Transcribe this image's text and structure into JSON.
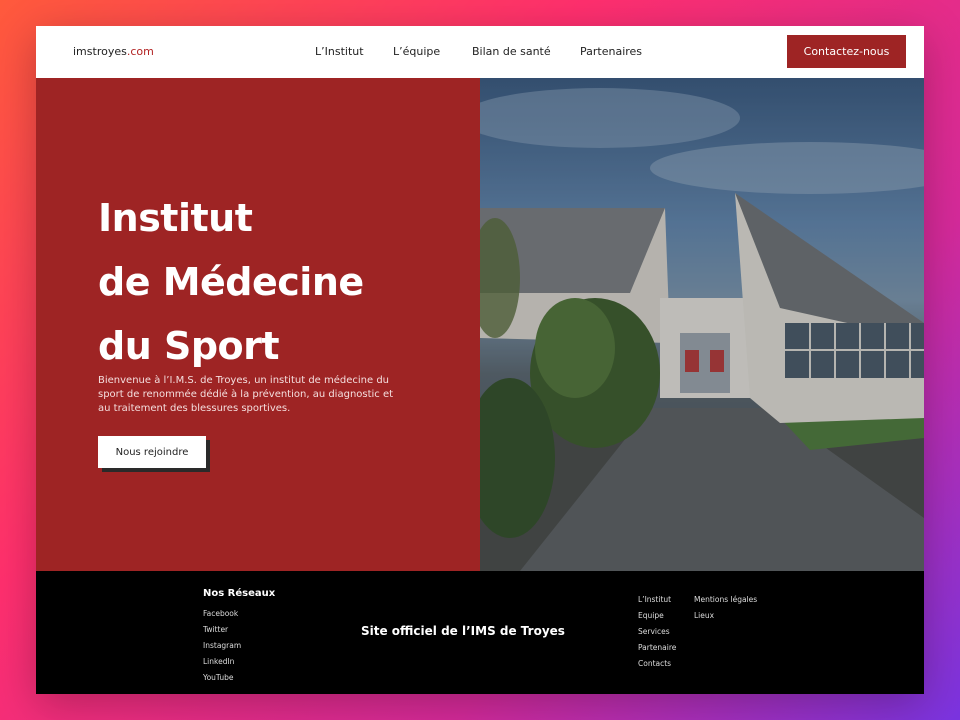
{
  "header": {
    "logo_main": "imstroyes",
    "logo_accent": ".com",
    "nav": [
      "L’Institut",
      "L’équipe",
      "Bilan de santé",
      "Partenaires"
    ],
    "cta": "Contactez-nous"
  },
  "hero": {
    "title_lines": [
      "Institut",
      "de Médecine",
      "du Sport"
    ],
    "description": "Bienvenue à l’I.M.S. de Troyes, un institut de médecine du sport de renommée dédié à la prévention, au diagnostic et au traitement des blessures sportives.",
    "button": "Nous rejoindre"
  },
  "footer": {
    "networks_title": "Nos Réseaux",
    "networks": [
      "Facebook",
      "Twitter",
      "Instagram",
      "LinkedIn",
      "YouTube"
    ],
    "center_text": "Site officiel de l’IMS de Troyes",
    "links_col1": [
      "L’Institut",
      "Equipe",
      "Services",
      "Partenaire",
      "Contacts"
    ],
    "links_col2": [
      "Mentions légales",
      "Lieux"
    ]
  },
  "colors": {
    "brand_red": "#9e2424",
    "footer_bg": "#000000"
  }
}
